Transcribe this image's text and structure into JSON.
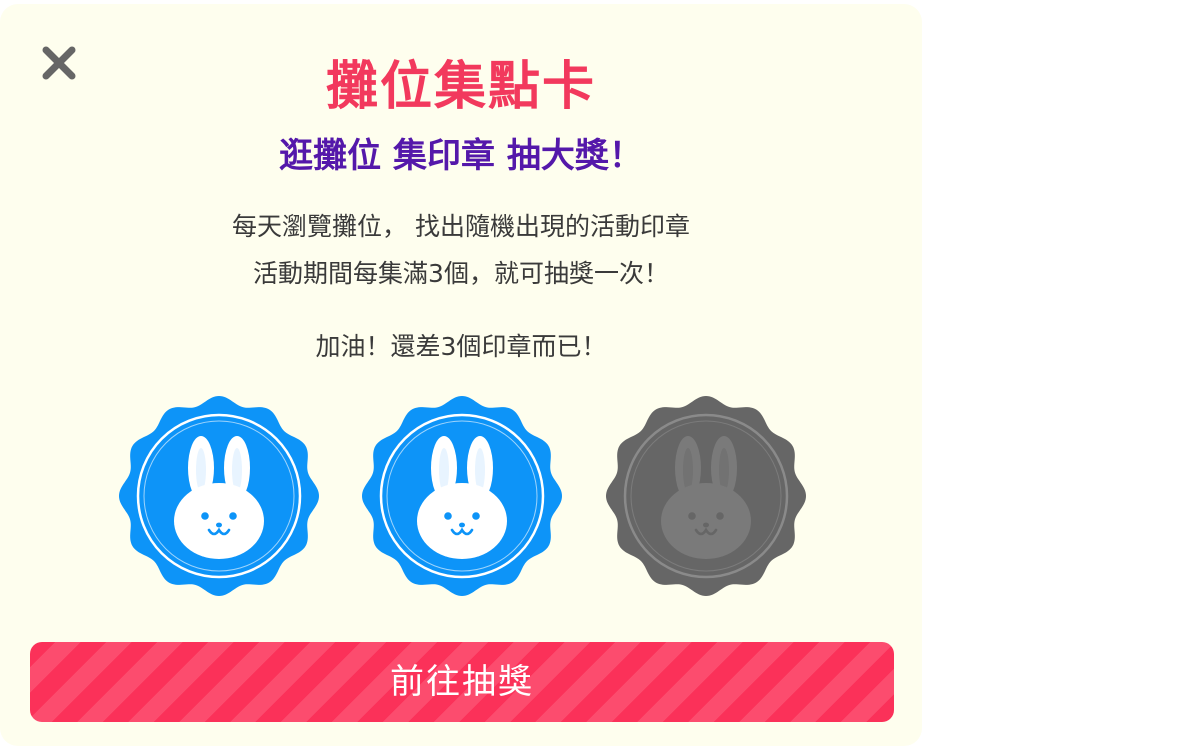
{
  "dialog": {
    "title": "攤位集點卡",
    "subtitle": "逛攤位 集印章 抽大獎！",
    "description_line1": "每天瀏覽攤位， 找出隨機出現的活動印章",
    "description_line2": "活動期間每集滿3個，就可抽獎一次！",
    "progress_message": "加油！還差3個印章而已！",
    "cta_label": "前往抽獎"
  },
  "stamps": [
    {
      "icon": "rabbit-icon",
      "collected": true,
      "color": "#0d94f8"
    },
    {
      "icon": "rabbit-icon",
      "collected": true,
      "color": "#0d94f8"
    },
    {
      "icon": "rabbit-icon",
      "collected": false,
      "color": "#666666"
    }
  ],
  "colors": {
    "title": "#f2395d",
    "subtitle": "#5418aa",
    "card_background": "#fefeee",
    "cta_background": "#fb3159",
    "close_icon": "#666666"
  }
}
